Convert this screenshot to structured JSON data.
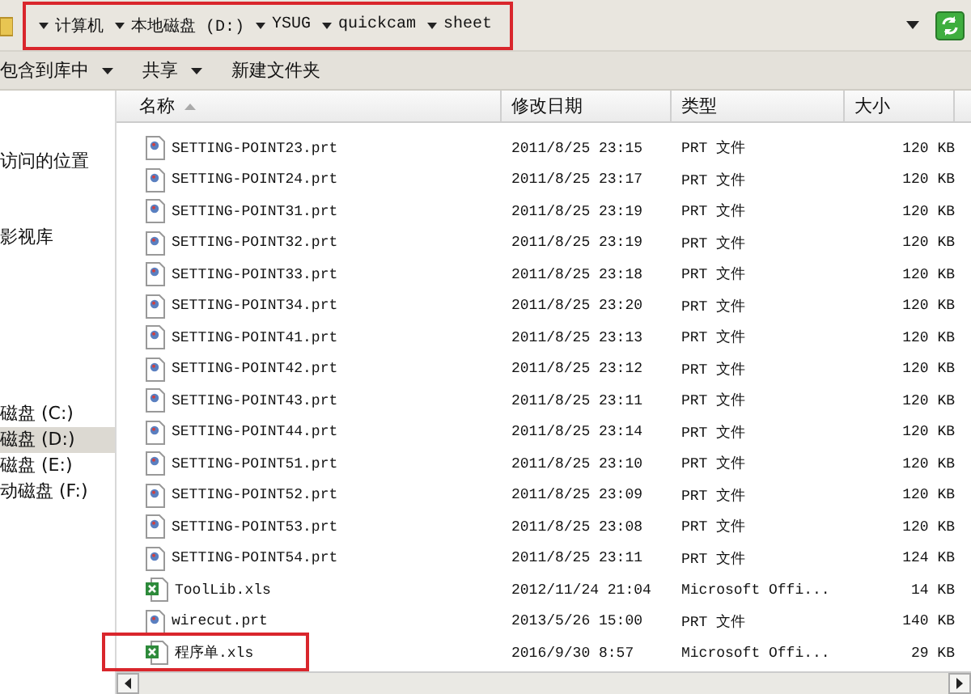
{
  "address_bar": {
    "highlighted": true,
    "crumbs": [
      "计算机",
      "本地磁盘 (D:)",
      "YSUG",
      "quickcam",
      "sheet"
    ]
  },
  "toolbar": [
    {
      "label": "包含到库中",
      "dropdown": true
    },
    {
      "label": "共享",
      "dropdown": true
    },
    {
      "label": "新建文件夹",
      "dropdown": false
    }
  ],
  "sidebar": {
    "favorites": [
      {
        "label": "访问的位置",
        "selected": false
      },
      {
        "label": "影视库",
        "selected": false
      }
    ],
    "drives": [
      {
        "label": "磁盘 (C:)",
        "selected": false
      },
      {
        "label": "磁盘 (D:)",
        "selected": true
      },
      {
        "label": "磁盘 (E:)",
        "selected": false
      },
      {
        "label": "动磁盘 (F:)",
        "selected": false
      }
    ]
  },
  "table": {
    "columns": [
      "名称",
      "修改日期",
      "类型",
      "大小"
    ],
    "rows": [
      {
        "kind": "prt",
        "name": "SETTING-POINT23.prt",
        "date": "2011/8/25 23:15",
        "type": "PRT 文件",
        "size": "120 KB",
        "highlighted": false
      },
      {
        "kind": "prt",
        "name": "SETTING-POINT24.prt",
        "date": "2011/8/25 23:17",
        "type": "PRT 文件",
        "size": "120 KB",
        "highlighted": false
      },
      {
        "kind": "prt",
        "name": "SETTING-POINT31.prt",
        "date": "2011/8/25 23:19",
        "type": "PRT 文件",
        "size": "120 KB",
        "highlighted": false
      },
      {
        "kind": "prt",
        "name": "SETTING-POINT32.prt",
        "date": "2011/8/25 23:19",
        "type": "PRT 文件",
        "size": "120 KB",
        "highlighted": false
      },
      {
        "kind": "prt",
        "name": "SETTING-POINT33.prt",
        "date": "2011/8/25 23:18",
        "type": "PRT 文件",
        "size": "120 KB",
        "highlighted": false
      },
      {
        "kind": "prt",
        "name": "SETTING-POINT34.prt",
        "date": "2011/8/25 23:20",
        "type": "PRT 文件",
        "size": "120 KB",
        "highlighted": false
      },
      {
        "kind": "prt",
        "name": "SETTING-POINT41.prt",
        "date": "2011/8/25 23:13",
        "type": "PRT 文件",
        "size": "120 KB",
        "highlighted": false
      },
      {
        "kind": "prt",
        "name": "SETTING-POINT42.prt",
        "date": "2011/8/25 23:12",
        "type": "PRT 文件",
        "size": "120 KB",
        "highlighted": false
      },
      {
        "kind": "prt",
        "name": "SETTING-POINT43.prt",
        "date": "2011/8/25 23:11",
        "type": "PRT 文件",
        "size": "120 KB",
        "highlighted": false
      },
      {
        "kind": "prt",
        "name": "SETTING-POINT44.prt",
        "date": "2011/8/25 23:14",
        "type": "PRT 文件",
        "size": "120 KB",
        "highlighted": false
      },
      {
        "kind": "prt",
        "name": "SETTING-POINT51.prt",
        "date": "2011/8/25 23:10",
        "type": "PRT 文件",
        "size": "120 KB",
        "highlighted": false
      },
      {
        "kind": "prt",
        "name": "SETTING-POINT52.prt",
        "date": "2011/8/25 23:09",
        "type": "PRT 文件",
        "size": "120 KB",
        "highlighted": false
      },
      {
        "kind": "prt",
        "name": "SETTING-POINT53.prt",
        "date": "2011/8/25 23:08",
        "type": "PRT 文件",
        "size": "120 KB",
        "highlighted": false
      },
      {
        "kind": "prt",
        "name": "SETTING-POINT54.prt",
        "date": "2011/8/25 23:11",
        "type": "PRT 文件",
        "size": "124 KB",
        "highlighted": false
      },
      {
        "kind": "xls",
        "name": "ToolLib.xls",
        "date": "2012/11/24 21:04",
        "type": "Microsoft Offi...",
        "size": "14 KB",
        "highlighted": false
      },
      {
        "kind": "prt",
        "name": "wirecut.prt",
        "date": "2013/5/26 15:00",
        "type": "PRT 文件",
        "size": "140 KB",
        "highlighted": false
      },
      {
        "kind": "xls",
        "name": "程序单.xls",
        "date": "2016/9/30 8:57",
        "type": "Microsoft Offi...",
        "size": "29 KB",
        "highlighted": true
      }
    ]
  }
}
